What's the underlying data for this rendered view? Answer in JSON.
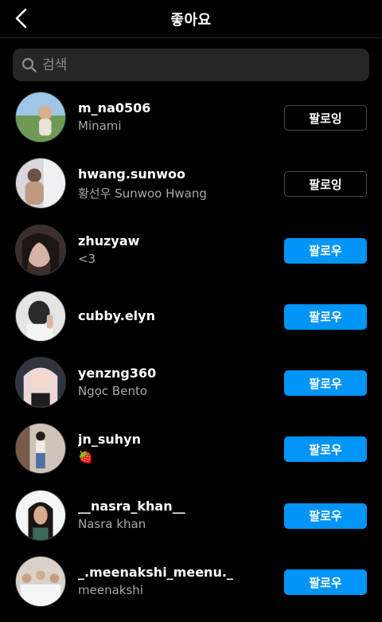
{
  "header": {
    "title": "좋아요",
    "back_icon": "chevron-left-icon"
  },
  "search": {
    "placeholder": "검색",
    "value": ""
  },
  "colors": {
    "follow_blue": "#0095f6",
    "background": "#000000",
    "secondary_text": "#a8a8a8"
  },
  "users": [
    {
      "username": "m_na0506",
      "name": "Minami",
      "button": "팔로잉",
      "state": "following"
    },
    {
      "username": "hwang.sunwoo",
      "name": "황선우 Sunwoo Hwang",
      "button": "팔로잉",
      "state": "following"
    },
    {
      "username": "zhuzyaw",
      "name": "<3",
      "button": "팔로우",
      "state": "follow"
    },
    {
      "username": "cubby.elyn",
      "name": "",
      "button": "팔로우",
      "state": "follow"
    },
    {
      "username": "yenzng360",
      "name": "Ngọc Bento",
      "button": "팔로우",
      "state": "follow"
    },
    {
      "username": "jn_suhyn",
      "name": "🍓",
      "button": "팔로우",
      "state": "follow"
    },
    {
      "username": "__nasra_khan__",
      "name": "Nasra khan",
      "button": "팔로우",
      "state": "follow"
    },
    {
      "username": "_.meenakshi_meenu._",
      "name": "meenakshi",
      "button": "팔로우",
      "state": "follow"
    }
  ]
}
